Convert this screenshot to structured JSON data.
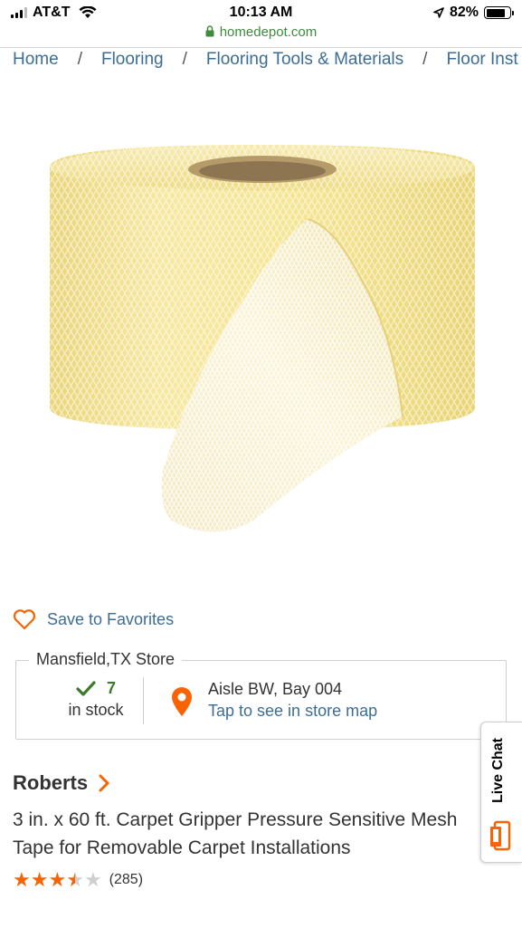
{
  "status_bar": {
    "carrier": "AT&T",
    "time": "10:13 AM",
    "battery": "82%",
    "battery_level": 0.82
  },
  "browser": {
    "url": "homedepot.com"
  },
  "breadcrumb": [
    "Home",
    "Flooring",
    "Flooring Tools & Materials",
    "Floor Inst"
  ],
  "product_image": {
    "alt": "yellow carpet gripper mesh tape roll"
  },
  "favorites": {
    "label": "Save to Favorites"
  },
  "store": {
    "name": "Mansfield,TX Store",
    "stock_count": "7",
    "stock_label": "in stock",
    "aisle": "Aisle BW, Bay 004",
    "map_link": "Tap to see in store map"
  },
  "product": {
    "brand": "Roberts",
    "title": "3 in. x 60 ft. Carpet Gripper Pressure Sensitive Mesh Tape for Removable Carpet Installations",
    "rating": 3.5,
    "review_count": "(285)"
  },
  "live_chat": {
    "label": "Live Chat"
  },
  "colors": {
    "link": "#3d6d94",
    "brand_orange": "#f96302",
    "stock_green": "#3b7a2a",
    "url_green": "#3c8c3c"
  }
}
